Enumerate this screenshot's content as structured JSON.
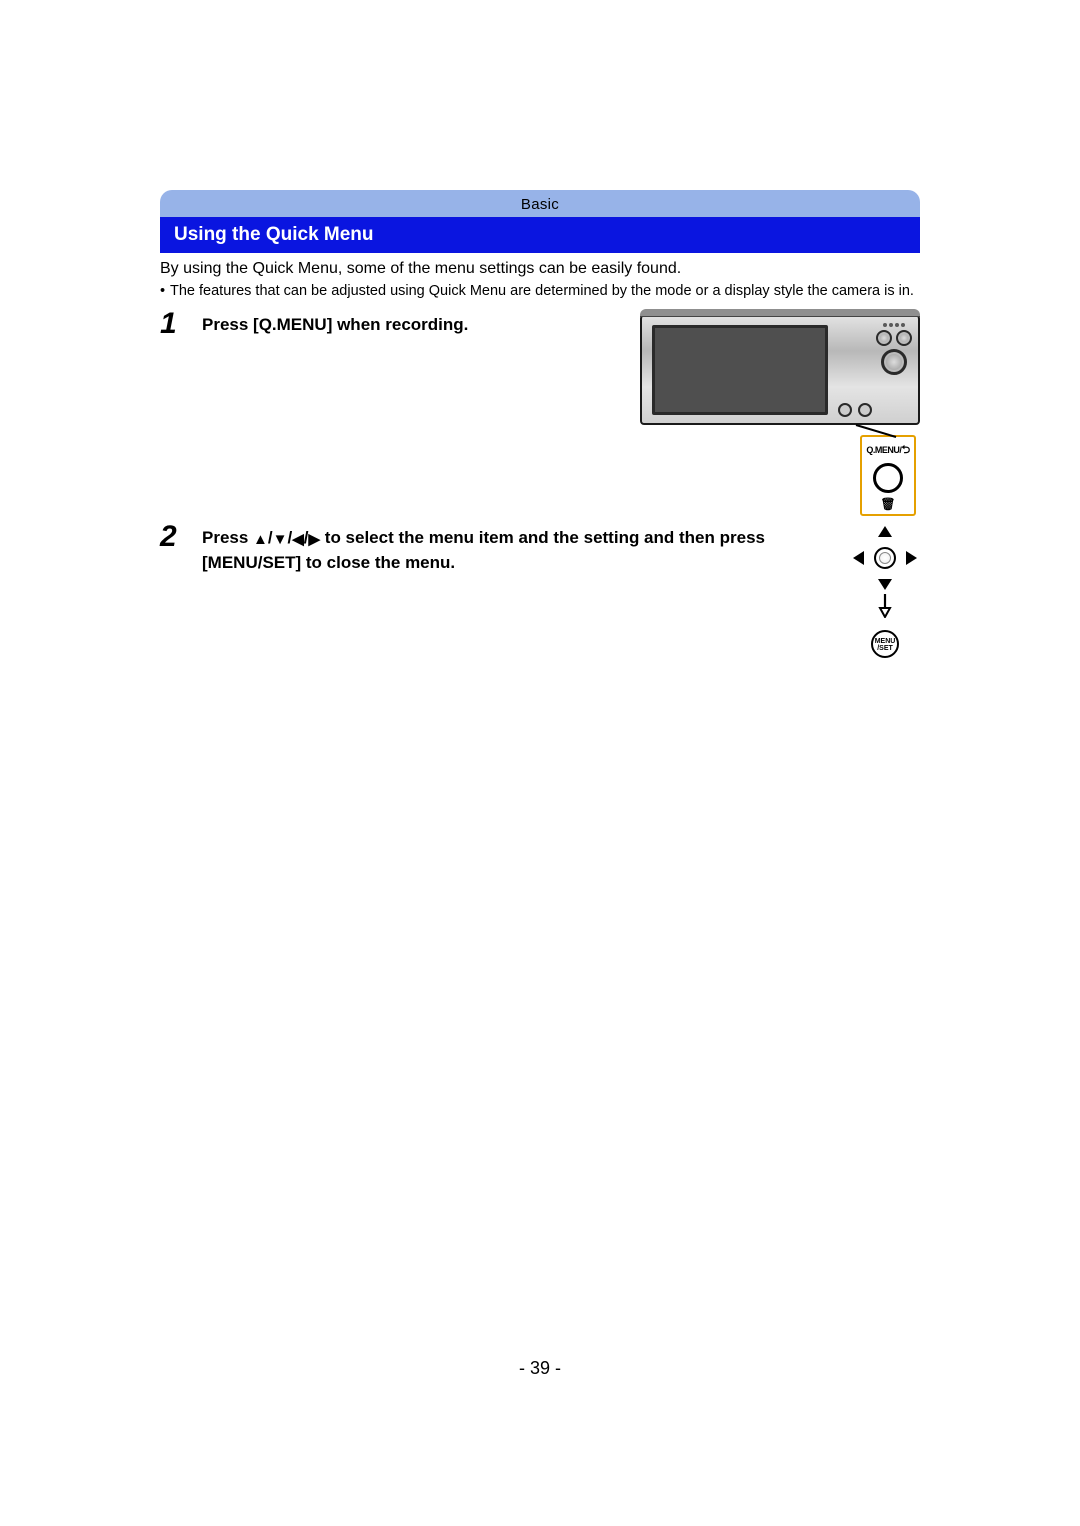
{
  "chapter": "Basic",
  "section_title": "Using the Quick Menu",
  "intro": "By using the Quick Menu, some of the menu settings can be easily found.",
  "note": "The features that can be adjusted using Quick Menu are determined by the mode or a display style the camera is in.",
  "steps": [
    {
      "num": "1",
      "text": "Press [Q.MENU] when recording."
    },
    {
      "num": "2",
      "text_pre": "Press ",
      "text_post": " to select the menu item and the setting and then press [MENU/SET] to close the menu."
    }
  ],
  "callout_label": "Q.MENU/",
  "menuset_label_1": "MENU",
  "menuset_label_2": "/SET",
  "page_number": "- 39 -"
}
